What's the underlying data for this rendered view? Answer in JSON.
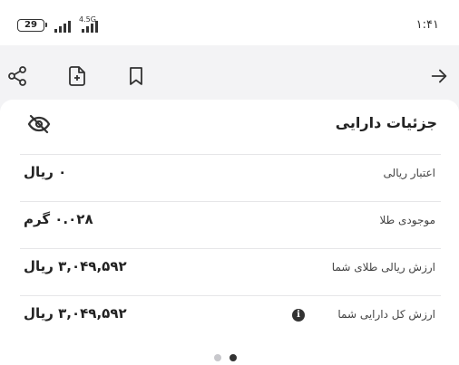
{
  "status_bar": {
    "battery": "29",
    "network": "4.5G",
    "time": "۱:۴۱"
  },
  "toolbar": {
    "icons": [
      "share-icon",
      "add-file-icon",
      "bookmark-icon",
      "arrow-right-icon"
    ]
  },
  "card": {
    "title": "جزئیات دارایی",
    "rows": [
      {
        "label": "اعتبار ریالی",
        "value": "۰ ریال"
      },
      {
        "label": "موجودی طلا",
        "value": "۰.۰۲۸ گرم"
      },
      {
        "label": "ارزش ریالی طلای شما",
        "value": "۳,۰۴۹,۵۹۲ ریال"
      },
      {
        "label": "ارزش کل دارایی شما",
        "value": "۳,۰۴۹,۵۹۲ ریال",
        "info_icon": "i"
      }
    ]
  },
  "pager": {
    "pages": 2,
    "active_index": 1
  }
}
